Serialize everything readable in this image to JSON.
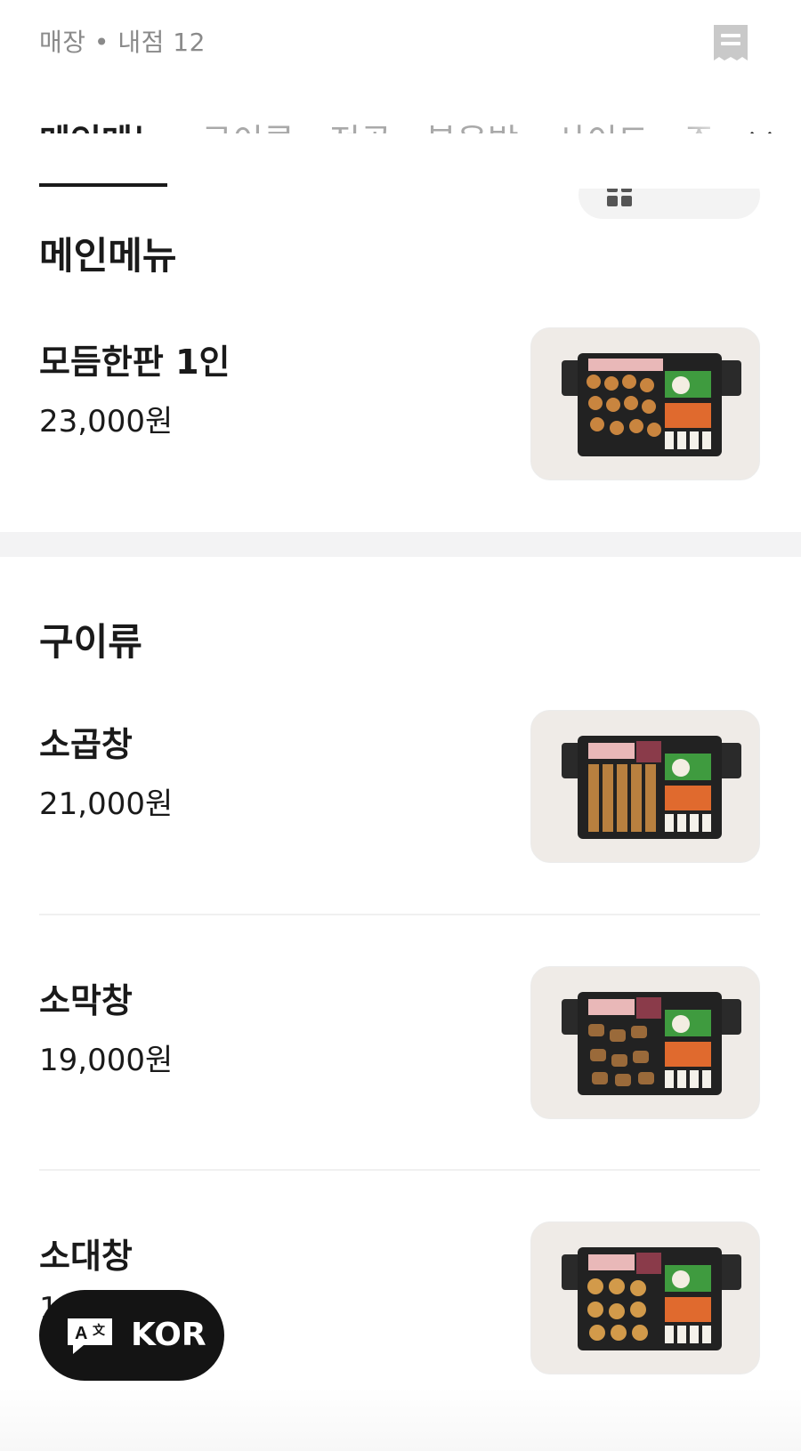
{
  "header": {
    "store_info": "매장 • 내점 12",
    "receipt_icon": "receipt-icon"
  },
  "tabs": [
    {
      "label": "메인메뉴",
      "active": true
    },
    {
      "label": "구이류",
      "active": false
    },
    {
      "label": "전골",
      "active": false
    },
    {
      "label": "볶음밥",
      "active": false
    },
    {
      "label": "사이드",
      "active": false
    },
    {
      "label": "주",
      "active": false
    }
  ],
  "tabs_expand_icon": "chevron-down-icon",
  "view_toggle": {
    "icon": "grid-icon"
  },
  "sections": [
    {
      "title": "메인메뉴",
      "items": [
        {
          "name": "모듬한판 1인",
          "price": "23,000원"
        }
      ]
    },
    {
      "title": "구이류",
      "items": [
        {
          "name": "소곱창",
          "price": "21,000원"
        },
        {
          "name": "소막창",
          "price": "19,000원"
        },
        {
          "name": "소대창",
          "price": "1"
        }
      ]
    }
  ],
  "language_button": {
    "label": "KOR",
    "icon": "translate-icon"
  },
  "colors": {
    "text_primary": "#1a1a1a",
    "text_muted": "#a9a9a9",
    "divider": "#f3f3f4",
    "lang_button_bg": "#141414"
  }
}
